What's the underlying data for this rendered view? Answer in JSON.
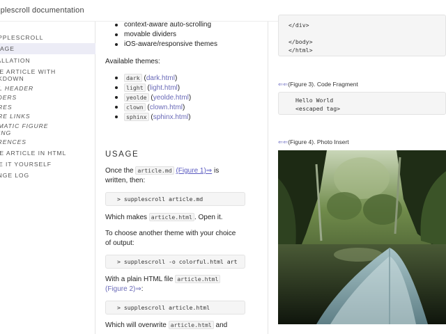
{
  "app": {
    "title": "upplescroll documentation"
  },
  "sidebar": {
    "items": [
      {
        "label": "UPPLESCROLL"
      },
      {
        "label": "AGE"
      },
      {
        "label": "TALLATION"
      },
      {
        "label": "ITE ARTICLE WITH"
      },
      {
        "label": "RKDOWN"
      },
      {
        "label": "ML HEADER"
      },
      {
        "label": "ADERS"
      },
      {
        "label": "URES"
      },
      {
        "label": "URE LINKS"
      },
      {
        "label": "OMATIC FIGURE"
      },
      {
        "label": "MING"
      },
      {
        "label": "ERENCES"
      },
      {
        "label": "ITE ARTICLE IN HTML"
      },
      {
        "label": "ME IT YOURSELF"
      },
      {
        "label": "ANGE LOG"
      }
    ]
  },
  "main": {
    "features": [
      "context-aware auto-scrolling",
      "movable dividers",
      "iOS-aware/responsive themes"
    ],
    "themes_intro": "Available themes:",
    "themes": [
      {
        "code": "dark",
        "link": "dark.html"
      },
      {
        "code": "light",
        "link": "light.html"
      },
      {
        "code": "yeolde",
        "link": "yeolde.html"
      },
      {
        "code": "clown",
        "link": "clown.html"
      },
      {
        "code": "sphinx",
        "link": "sphinx.html"
      }
    ],
    "usage_heading": "USAGE",
    "p1_pre": "Once the",
    "p1_code": "article.md",
    "p1_fig": "(Figure 1)⇒",
    "p1_post": "is",
    "p1_line2": "written, then:",
    "code1": "> supplescroll article.md",
    "p2_pre": "Which makes",
    "p2_code": "article.html",
    "p2_post": ". Open it.",
    "p3_line1": "To choose another theme with your choice",
    "p3_line2": "of output:",
    "code2": "> supplescroll -o colorful.html art",
    "p4_pre": "With a plain HTML file",
    "p4_code": "article.html",
    "p4_fig": "(Figure 2)⇒",
    "p4_post": ":",
    "code3": "> supplescroll article.html",
    "p5_pre": "Which will overwrite",
    "p5_code": "article.html",
    "p5_post": "and"
  },
  "right": {
    "code_top": "</div>\n\n</body>\n</html>",
    "fig3_arrows": "⇐⇐",
    "fig3_caption": "(Figure 3). Code Fragment",
    "code_fig3": "Hello World\n<escaped tag>",
    "fig4_arrows": "⇐⇐",
    "fig4_caption": "(Figure 4). Photo Insert"
  },
  "colors": {
    "link": "#6a6ab8",
    "active_nav_bg": "#ececf6",
    "code_bg": "#f5f5f5"
  }
}
